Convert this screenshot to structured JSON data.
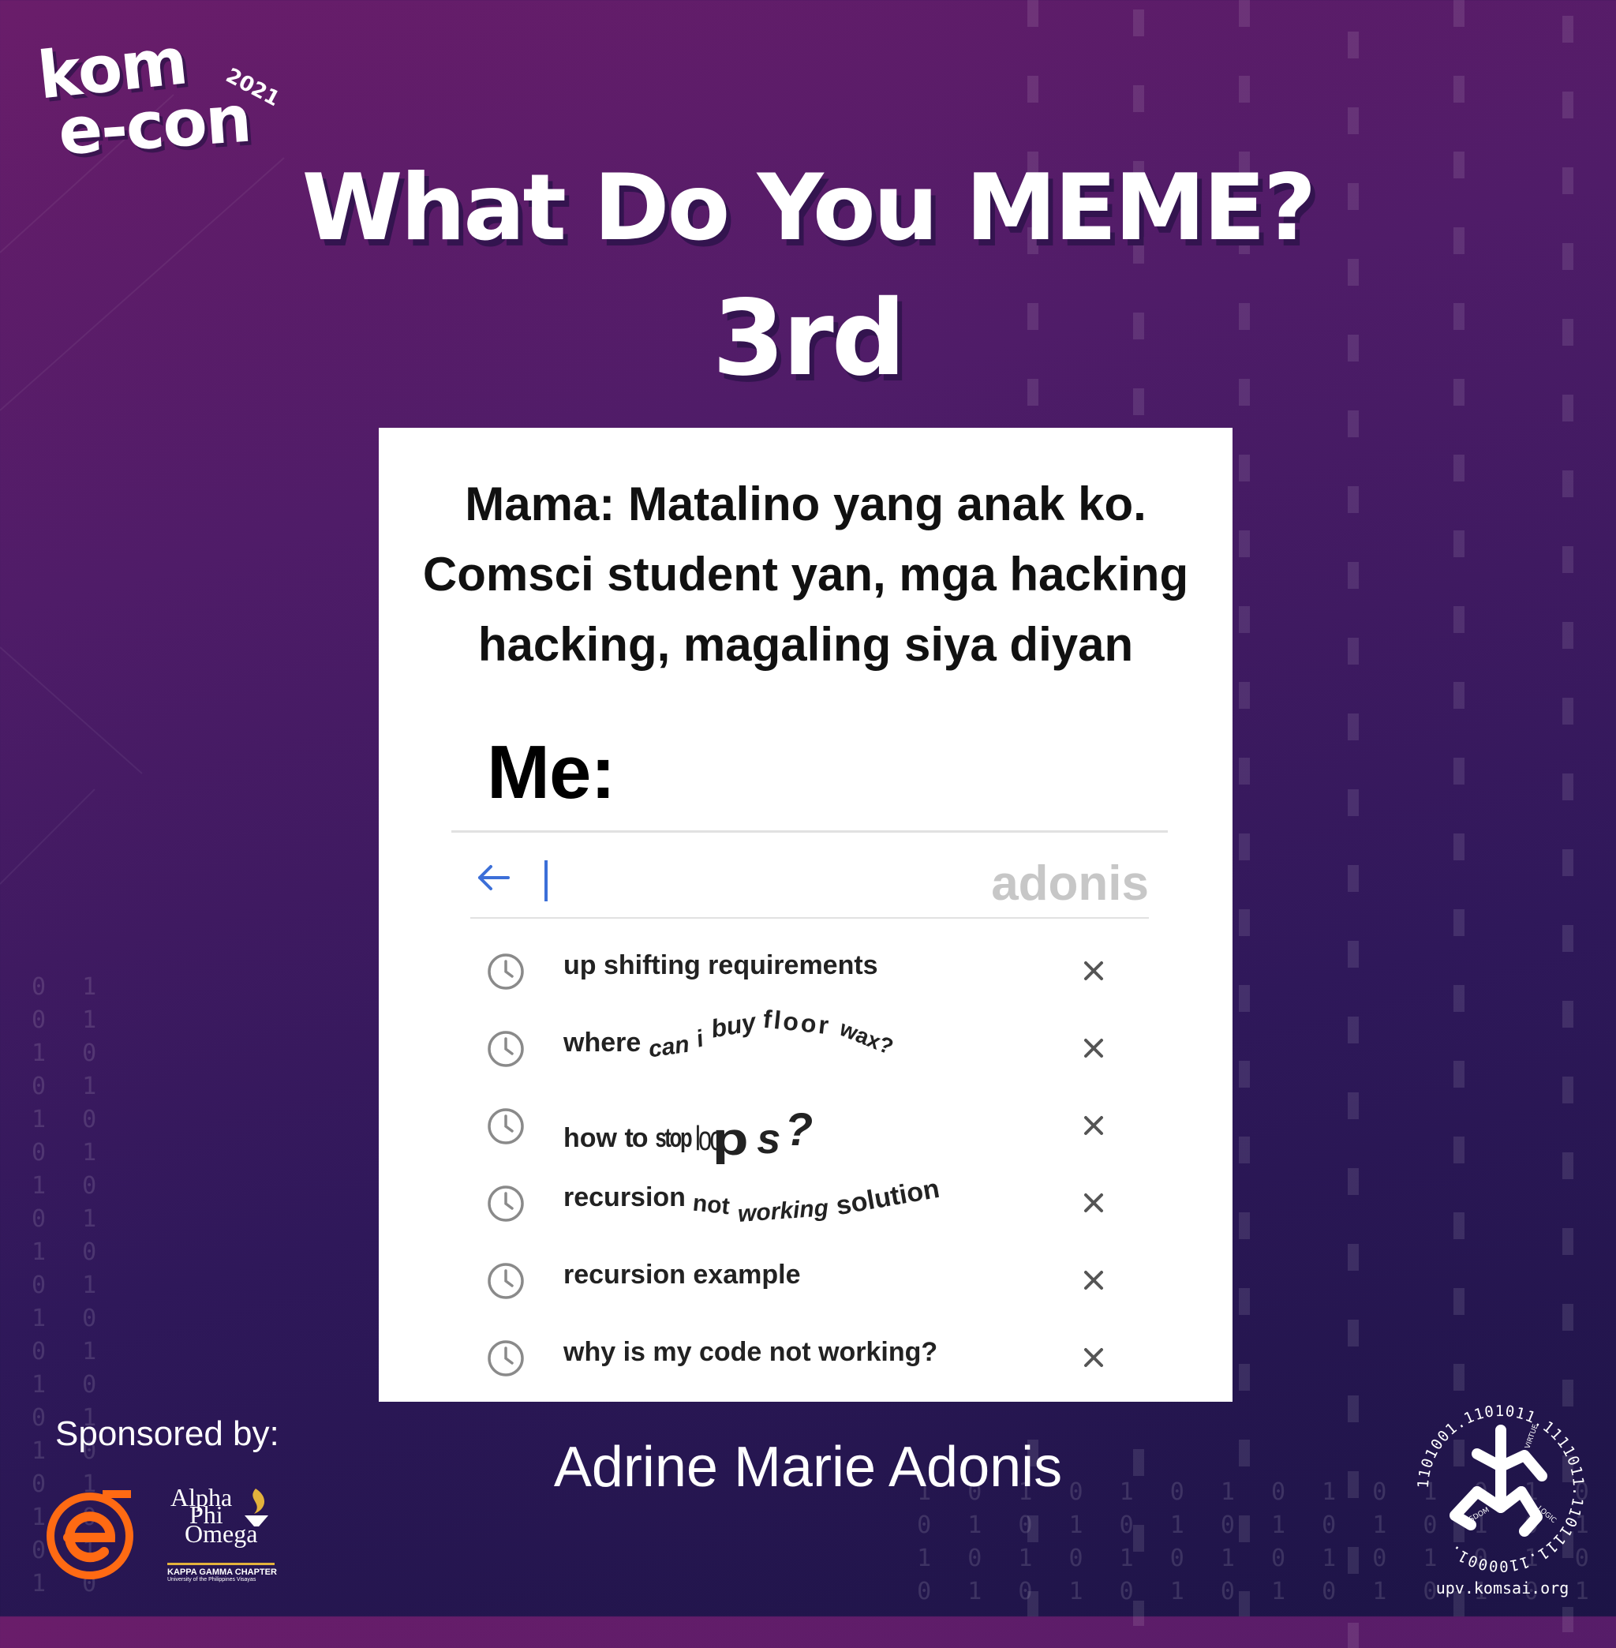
{
  "logo": {
    "line1": "kom",
    "line2": "e-con",
    "year": "2021"
  },
  "title": "What Do You MEME?",
  "place": "3rd",
  "meme": {
    "caption_lines": [
      "Mama: Matalino yang anak ko.",
      "Comsci student yan, mga hacking",
      "hacking, magaling siya diyan"
    ],
    "me_label": "Me:",
    "search_name": "adonis",
    "results": [
      {
        "words": [
          "up shifting requirements"
        ]
      },
      {
        "words": [
          "where",
          "can",
          "i",
          "buy",
          "floor",
          "wax?"
        ]
      },
      {
        "words": [
          "how",
          "to",
          "stop",
          "loo",
          "p",
          "s",
          "?"
        ]
      },
      {
        "words": [
          "recursion",
          "not",
          "working",
          "solution"
        ]
      },
      {
        "words": [
          "recursion example"
        ]
      },
      {
        "words": [
          "why is my code not working?"
        ]
      }
    ]
  },
  "sponsors": {
    "label": "Sponsored by:",
    "apo": {
      "line1": "Alpha",
      "line2": "Phi",
      "line3": "Omega",
      "chapter": "KAPPA GAMMA CHAPTER",
      "university": "University of the Philippines Visayas"
    }
  },
  "winner_name": "Adrine Marie Adonis",
  "komsai": {
    "url": "upv.komsai.org",
    "ring_text": "1101001.1101011.1111011.1101111.1100001.",
    "words": [
      "VIRTUE",
      "LOGIC",
      "WISDOM"
    ]
  },
  "colors": {
    "accent_orange": "#ff6a13",
    "search_blue": "#3c6fd8",
    "bg_top": "#6a1d6a",
    "bg_bottom": "#1c1446"
  }
}
